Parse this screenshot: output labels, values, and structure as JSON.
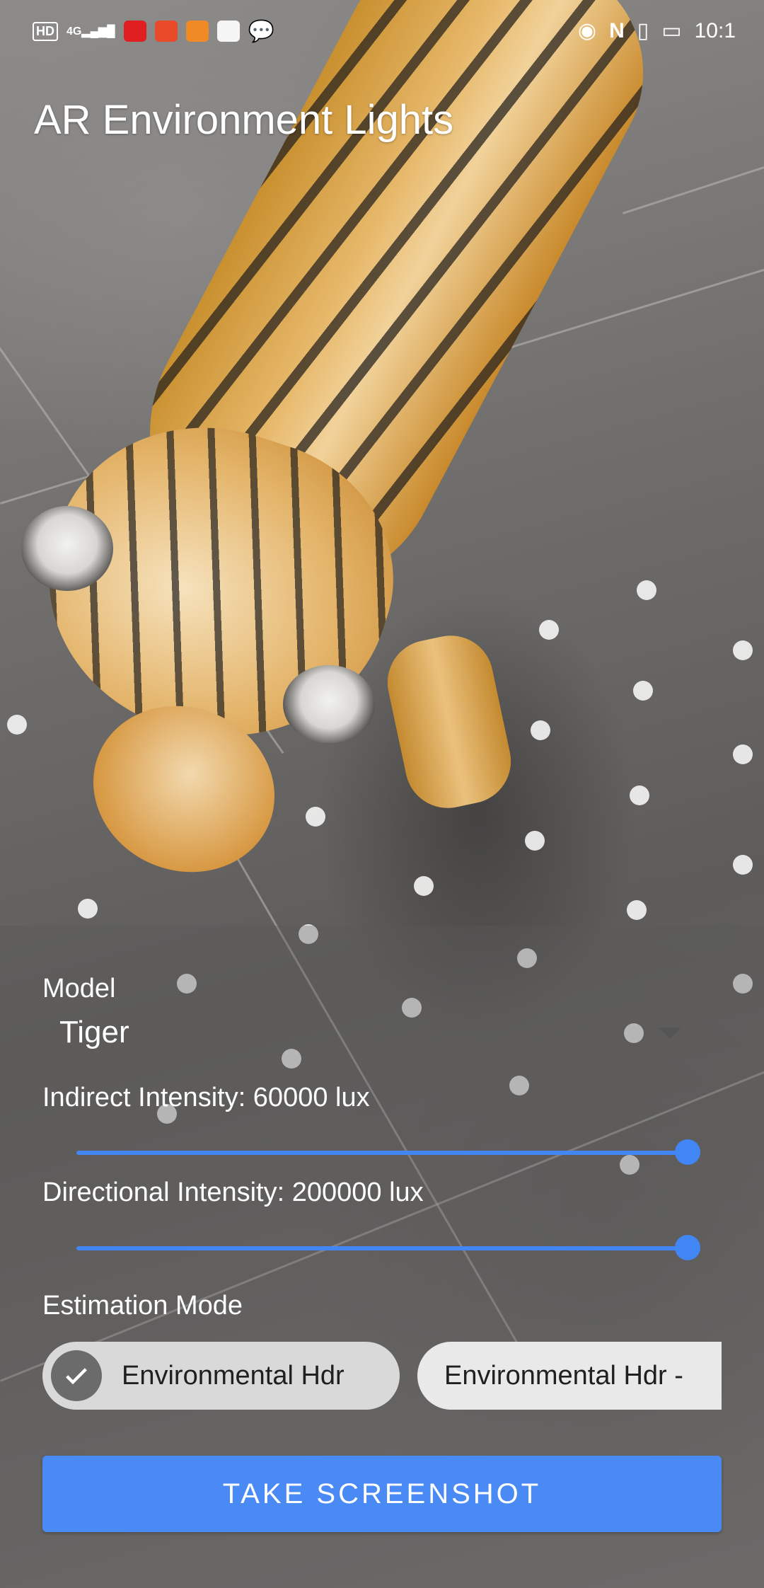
{
  "status_bar": {
    "left_icons": [
      "hd-icon",
      "4g-signal-icon",
      "video-app-icon",
      "news-app-icon",
      "play-app-icon",
      "gift-app-icon",
      "wechat-icon"
    ],
    "right_icons": [
      "eye-icon",
      "nfc-icon",
      "vibrate-icon",
      "battery-icon"
    ],
    "time": "10:1"
  },
  "app": {
    "title": "AR Environment Lights"
  },
  "controls": {
    "model_label": "Model",
    "model_value": "Tiger",
    "indirect_label": "Indirect Intensity: 60000 lux",
    "indirect_value_fraction": 1.0,
    "directional_label": "Directional Intensity: 200000 lux",
    "directional_value_fraction": 1.0,
    "estimation_label": "Estimation Mode",
    "estimation_options": [
      {
        "label": "Environmental Hdr",
        "selected": true
      },
      {
        "label": "Environmental Hdr -",
        "selected": false
      }
    ],
    "screenshot_button": "TAKE SCREENSHOT"
  },
  "colors": {
    "accent": "#4285f4",
    "button": "#4a8af4"
  }
}
